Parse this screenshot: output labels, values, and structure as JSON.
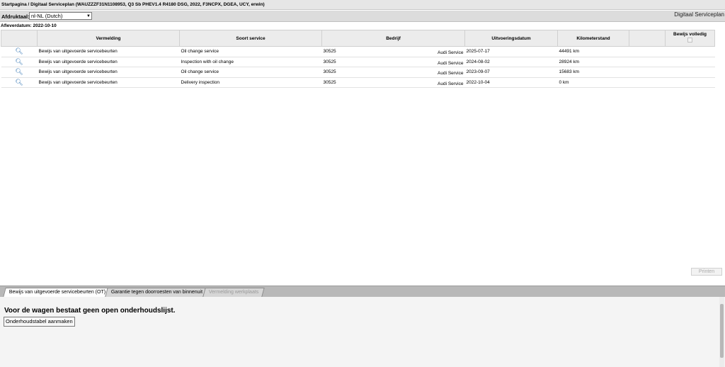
{
  "window": {
    "breadcrumb": "Startpagina / Digitaal Serviceplan (WAUZZZF31N1108953, Q3 Sb PHEV1.4 R4180 DSG, 2022, F3NCPX, DGEA, UCY, erwin)"
  },
  "toolbar": {
    "language_label": "Afdruktaal:",
    "language_value": "nl-NL (Dutch)",
    "module_title": "Digitaal Serviceplan"
  },
  "delivery": {
    "text": "Afleverdatum: 2022-10-10"
  },
  "table": {
    "headers": {
      "vermelding": "Vermelding",
      "soort": "Soort service",
      "bedrijf": "Bedrijf",
      "datum": "Uitvoeringsdatum",
      "km": "Kilometerstand",
      "bewijs": "Bewijs volledig"
    },
    "rows": [
      {
        "vermelding": "Bewijs van uitgevoerde servicebeurten",
        "soort": "Oil change service",
        "code": "30525",
        "bedrijf": "Audi Service",
        "datum": "2025-07-17",
        "km": "44491 km"
      },
      {
        "vermelding": "Bewijs van uitgevoerde servicebeurten",
        "soort": "Inspection with oil change",
        "code": "30525",
        "bedrijf": "Audi Service",
        "datum": "2024-08-02",
        "km": "28924 km"
      },
      {
        "vermelding": "Bewijs van uitgevoerde servicebeurten",
        "soort": "Oil change service",
        "code": "30525",
        "bedrijf": "Audi Service",
        "datum": "2023-09-07",
        "km": "15683 km"
      },
      {
        "vermelding": "Bewijs van uitgevoerde servicebeurten",
        "soort": "Delivery inspection",
        "code": "30525",
        "bedrijf": "Audi Service",
        "datum": "2022-10-04",
        "km": "0 km"
      }
    ]
  },
  "actions": {
    "print": "Printen"
  },
  "tabs": [
    {
      "label": "Bewijs van uitgevoerde servicebeurten (OT)"
    },
    {
      "label": "Garantie tegen doorroesten van binnenuit"
    },
    {
      "label": "Vermelding werkplaats"
    }
  ],
  "lower": {
    "message": "Voor de wagen bestaat geen open onderhoudslijst.",
    "create_button": "Onderhoudstabel aanmaken"
  }
}
